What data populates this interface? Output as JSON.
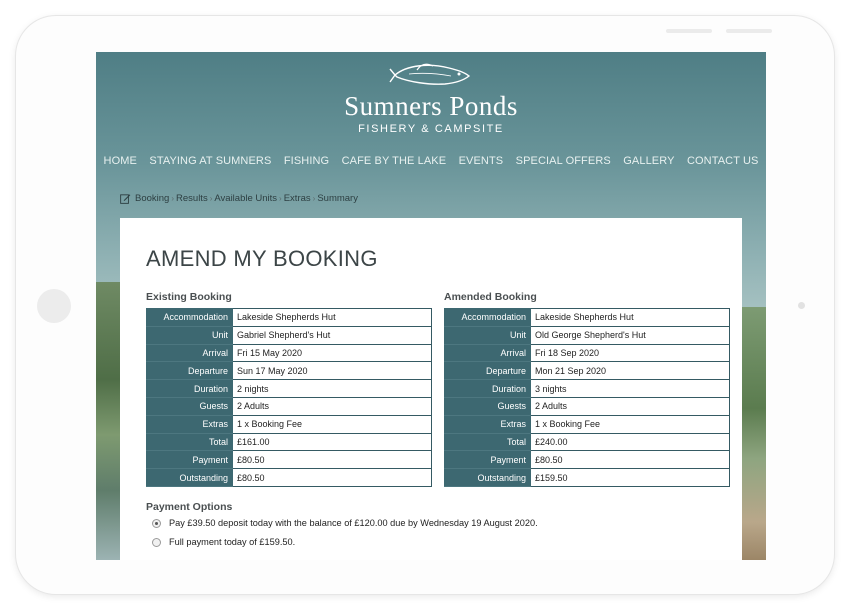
{
  "site": {
    "title": "Sumners Ponds",
    "subtitle": "FISHERY & CAMPSITE",
    "logo_icon": "fish-icon"
  },
  "nav": [
    {
      "label": "HOME"
    },
    {
      "label": "STAYING AT SUMNERS"
    },
    {
      "label": "FISHING"
    },
    {
      "label": "CAFE BY THE LAKE"
    },
    {
      "label": "EVENTS"
    },
    {
      "label": "SPECIAL OFFERS"
    },
    {
      "label": "GALLERY"
    },
    {
      "label": "CONTACT US"
    }
  ],
  "breadcrumb": {
    "icon": "edit-icon",
    "items": [
      {
        "label": "Booking"
      },
      {
        "label": "Results"
      },
      {
        "label": "Available Units"
      },
      {
        "label": "Extras"
      },
      {
        "label": "Summary"
      }
    ]
  },
  "page_title": "AMEND MY BOOKING",
  "existing": {
    "title": "Existing Booking",
    "rows": [
      {
        "label": "Accommodation",
        "value": "Lakeside Shepherds Hut"
      },
      {
        "label": "Unit",
        "value": "Gabriel Shepherd's Hut"
      },
      {
        "label": "Arrival",
        "value": "Fri 15 May 2020"
      },
      {
        "label": "Departure",
        "value": "Sun 17 May 2020"
      },
      {
        "label": "Duration",
        "value": "2 nights"
      },
      {
        "label": "Guests",
        "value": "2 Adults"
      },
      {
        "label": "Extras",
        "value": "1 x Booking Fee"
      },
      {
        "label": "Total",
        "value": "£161.00"
      },
      {
        "label": "Payment",
        "value": "£80.50"
      },
      {
        "label": "Outstanding",
        "value": "£80.50"
      }
    ]
  },
  "amended": {
    "title": "Amended Booking",
    "rows": [
      {
        "label": "Accommodation",
        "value": "Lakeside Shepherds Hut"
      },
      {
        "label": "Unit",
        "value": "Old George Shepherd's Hut"
      },
      {
        "label": "Arrival",
        "value": "Fri 18 Sep 2020"
      },
      {
        "label": "Departure",
        "value": "Mon 21 Sep 2020"
      },
      {
        "label": "Duration",
        "value": "3 nights"
      },
      {
        "label": "Guests",
        "value": "2 Adults"
      },
      {
        "label": "Extras",
        "value": "1 x Booking Fee"
      },
      {
        "label": "Total",
        "value": "£240.00"
      },
      {
        "label": "Payment",
        "value": "£80.50"
      },
      {
        "label": "Outstanding",
        "value": "£159.50"
      }
    ]
  },
  "payment": {
    "title": "Payment Options",
    "options": [
      {
        "label": "Pay £39.50 deposit today with the balance of £120.00 due by Wednesday 19 August 2020.",
        "selected": true
      },
      {
        "label": "Full payment today of £159.50.",
        "selected": false
      }
    ]
  },
  "colors": {
    "table_header": "#3d6871",
    "nav_text": "#e8f1f0",
    "sky_top": "#4f7e85"
  }
}
